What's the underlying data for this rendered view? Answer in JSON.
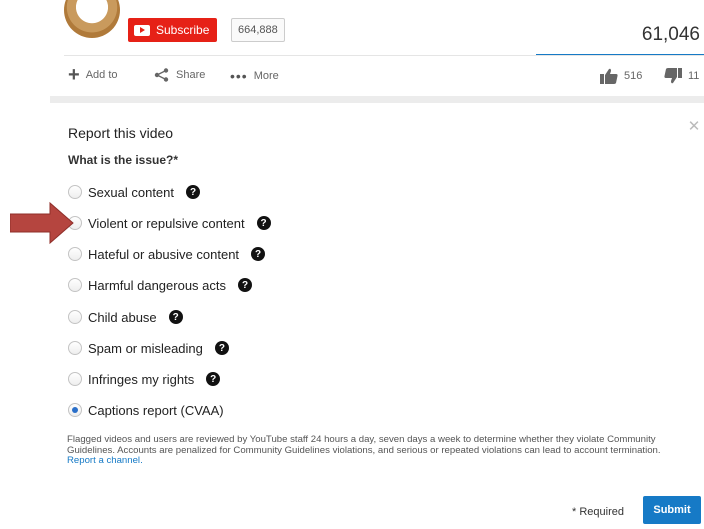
{
  "channel": {
    "subscribe_label": "Subscribe",
    "subscriber_count": "664,888"
  },
  "video": {
    "view_count": "61,046",
    "actions": {
      "add_to": "Add to",
      "share": "Share",
      "more": "More"
    },
    "likes": "516",
    "dislikes": "11"
  },
  "dialog": {
    "title": "Report this video",
    "question": "What is the issue?*",
    "close_icon": "close-icon",
    "options": [
      {
        "label": "Sexual content",
        "help": true,
        "selected": false
      },
      {
        "label": "Violent or repulsive content",
        "help": true,
        "selected": false
      },
      {
        "label": "Hateful or abusive content",
        "help": true,
        "selected": false
      },
      {
        "label": "Harmful dangerous acts",
        "help": true,
        "selected": false
      },
      {
        "label": "Child abuse",
        "help": true,
        "selected": false
      },
      {
        "label": "Spam or misleading",
        "help": true,
        "selected": false
      },
      {
        "label": "Infringes my rights",
        "help": true,
        "selected": false
      },
      {
        "label": "Captions report (CVAA)",
        "help": false,
        "selected": true
      }
    ],
    "help_glyph": "?",
    "disclaimer_text": "Flagged videos and users are reviewed by YouTube staff 24 hours a day, seven days a week to determine whether they violate Community Guidelines. Accounts are penalized for Community Guidelines violations, and serious or repeated violations can lead to account termination.",
    "disclaimer_link": "Report a channel.",
    "required_label": "* Required",
    "submit_label": "Submit"
  },
  "colors": {
    "subscribe_red": "#e62117",
    "link_blue": "#167ac6",
    "arrow_red": "#b5453f"
  }
}
